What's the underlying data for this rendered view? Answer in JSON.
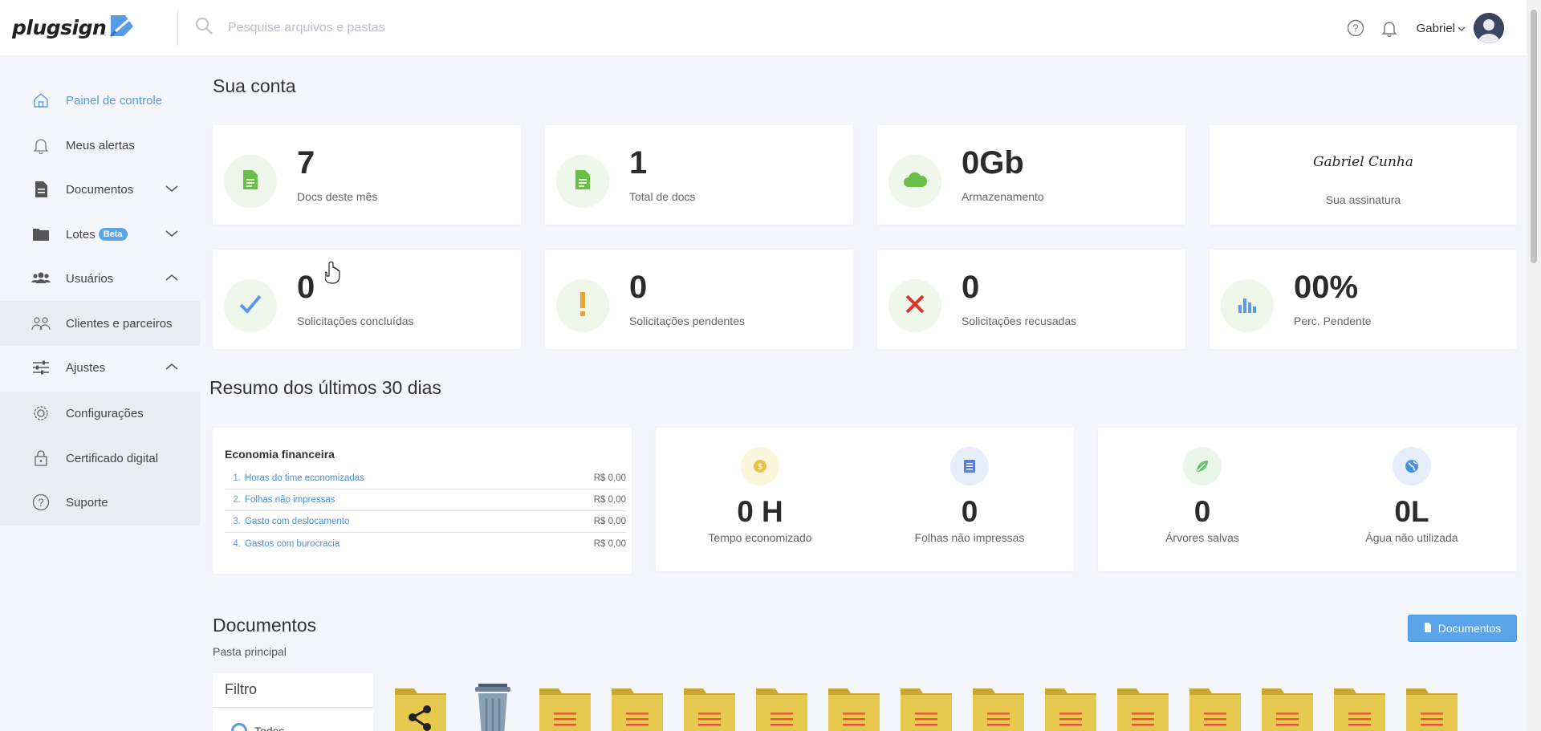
{
  "header": {
    "logo_text": "plugsign",
    "search_placeholder": "Pesquise arquivos e pastas",
    "user_name": "Gabriel"
  },
  "sidebar": {
    "items": [
      {
        "label": "Painel de controle",
        "icon": "home-icon"
      },
      {
        "label": "Meus alertas",
        "icon": "bell-icon"
      },
      {
        "label": "Documentos",
        "icon": "document-icon"
      },
      {
        "label": "Lotes",
        "icon": "folder-icon",
        "badge": "Beta"
      },
      {
        "label": "Usuários",
        "icon": "users-icon"
      },
      {
        "label": "Clientes e parceiros",
        "icon": "partners-icon"
      },
      {
        "label": "Ajustes",
        "icon": "sliders-icon"
      },
      {
        "label": "Configurações",
        "icon": "gear-icon"
      },
      {
        "label": "Certificado digital",
        "icon": "lock-icon"
      },
      {
        "label": "Suporte",
        "icon": "help-icon"
      }
    ]
  },
  "account": {
    "title": "Sua conta",
    "stats": [
      {
        "value": "7",
        "label": "Docs deste mês",
        "icon": "file-icon"
      },
      {
        "value": "1",
        "label": "Total de docs",
        "icon": "file-icon"
      },
      {
        "value": "0Gb",
        "label": "Armazenamento",
        "icon": "cloud-icon"
      },
      {
        "value": "0",
        "label": "Solicitações concluídas",
        "icon": "check-icon"
      },
      {
        "value": "0",
        "label": "Solicitações pendentes",
        "icon": "exclamation-icon"
      },
      {
        "value": "0",
        "label": "Solicitações recusadas",
        "icon": "x-icon"
      },
      {
        "value": "00%",
        "label": "Perc. Pendente",
        "icon": "bar-chart-icon"
      }
    ],
    "signature": {
      "text": "Gabriel Cunha",
      "label": "Sua assinatura"
    }
  },
  "summary": {
    "title": "Resumo dos últimos 30 dias",
    "economy": {
      "title": "Economia financeira",
      "rows": [
        {
          "num": "1.",
          "label": "Horas do time economizadas",
          "value": "R$ 0,00"
        },
        {
          "num": "2.",
          "label": "Folhas não impressas",
          "value": "R$ 0,00"
        },
        {
          "num": "3.",
          "label": "Gasto com deslocamento",
          "value": "R$ 0,00"
        },
        {
          "num": "4.",
          "label": "Gastos com burocracia",
          "value": "R$ 0,00"
        }
      ]
    },
    "metrics": [
      {
        "value": "0 H",
        "label": "Tempo economizado",
        "icon": "coin-icon",
        "color": "#e7c24a"
      },
      {
        "value": "0",
        "label": "Folhas não impressas",
        "icon": "book-icon",
        "color": "#5b7fd8"
      },
      {
        "value": "0",
        "label": "Árvores salvas",
        "icon": "leaf-icon",
        "color": "#6cc46c"
      },
      {
        "value": "0L",
        "label": "Água não utilizada",
        "icon": "globe-icon",
        "color": "#4a8fdc"
      }
    ]
  },
  "documents": {
    "title": "Documentos",
    "subtitle": "Pasta principal",
    "button_label": "Documentos",
    "filter_title": "Filtro",
    "filter_option": "Todos"
  },
  "colors": {
    "accent": "#5a9be8",
    "folder": "#e8c94f",
    "success": "#6cc04a"
  }
}
